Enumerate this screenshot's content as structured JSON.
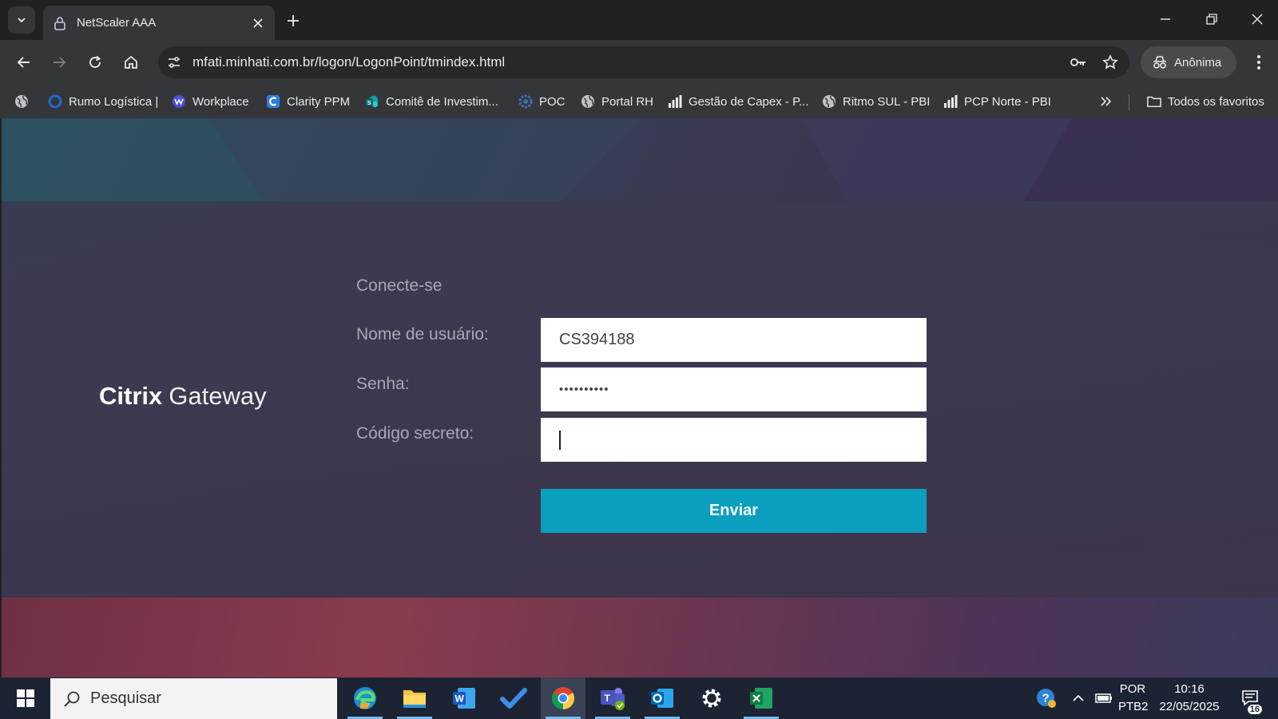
{
  "browser": {
    "tab_title": "NetScaler AAA",
    "url": "mfati.minhati.com.br/logon/LogonPoint/tmindex.html",
    "profile_label": "Anônima"
  },
  "bookmarks": {
    "items": [
      {
        "label": "Rumo Logística |",
        "icon": "rumo-icon"
      },
      {
        "label": "Workplace",
        "icon": "workplace-icon"
      },
      {
        "label": "Clarity PPM",
        "icon": "clarity-icon"
      },
      {
        "label": "Comitê de Investim...",
        "icon": "sharepoint-icon"
      },
      {
        "label": "POC",
        "icon": "gear-globe-icon"
      },
      {
        "label": "Portal RH",
        "icon": "globe-icon"
      },
      {
        "label": "Gestão de Capex - P...",
        "icon": "bar-chart-icon"
      },
      {
        "label": "Ritmo SUL - PBI",
        "icon": "globe-icon"
      },
      {
        "label": "PCP Norte - PBI",
        "icon": "bar-chart-icon"
      }
    ],
    "all_bookmarks_label": "Todos os favoritos"
  },
  "login": {
    "brand_strong": "Citrix",
    "brand_light": "Gateway",
    "title": "Conecte-se",
    "username_label": "Nome de usuário:",
    "username_value": "CS394188",
    "password_label": "Senha:",
    "password_value": "••••••••••",
    "secret_label": "Código secreto:",
    "secret_value": "",
    "submit_label": "Enviar"
  },
  "taskbar": {
    "search_placeholder": "Pesquisar",
    "language": "POR",
    "keyboard": "PTB2",
    "time": "10:16",
    "date": "22/05/2025",
    "notification_count": "16"
  },
  "colors": {
    "accent_button": "#0a9fbf",
    "tab_strip": "#202124",
    "toolbar": "#35363a",
    "taskbar": "#1c2434"
  }
}
